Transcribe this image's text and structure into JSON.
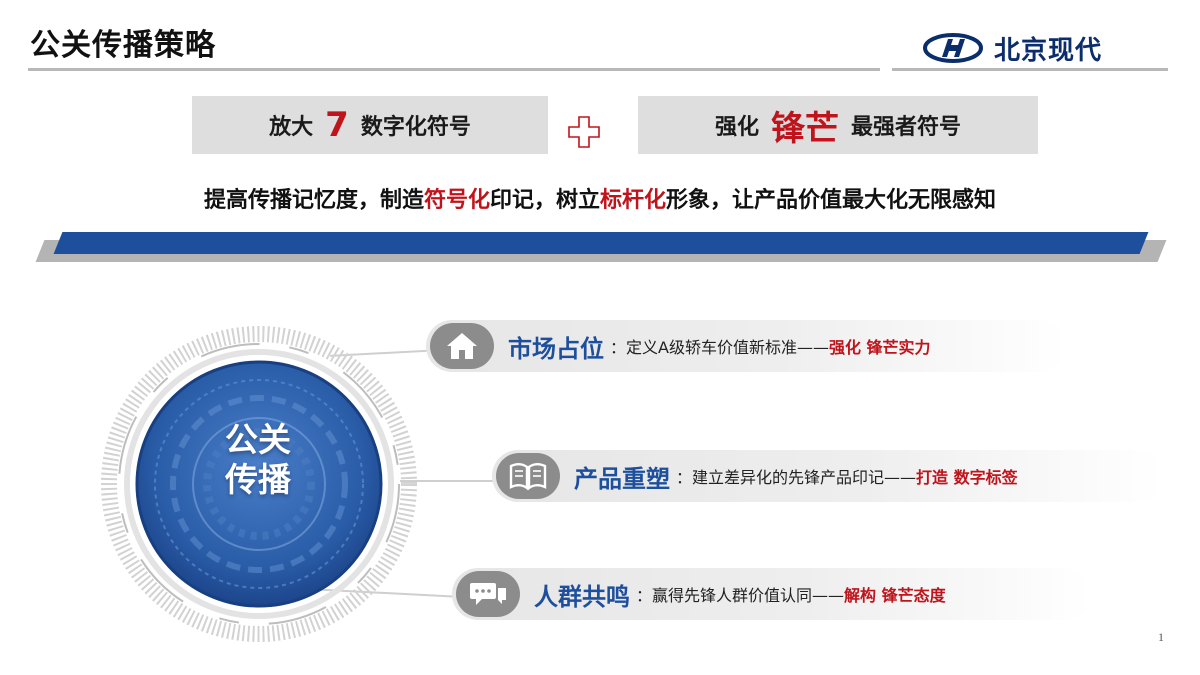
{
  "header": {
    "title": "公关传播策略",
    "logo_text": "北京现代",
    "logo_icon": "hyundai-logo-icon",
    "brand_color": "#0b2d6b"
  },
  "pills": {
    "left": {
      "prefix": "放大",
      "highlight": "7",
      "suffix": "数字化符号"
    },
    "right": {
      "prefix": "强化",
      "highlight": "锋芒",
      "suffix": "最强者符号"
    },
    "plus_icon": "plus-icon"
  },
  "slogan": {
    "part1": "提高传播记忆度，制造",
    "em1": "符号化",
    "part2": "印记，树立",
    "em2": "标杆化",
    "part3": "形象，让产品价值最大化无限感知"
  },
  "center": {
    "line1": "公关",
    "line2": "传播"
  },
  "items": [
    {
      "icon": "house-icon",
      "heading": "市场占位",
      "desc": "：定义A级轿车价值新标准——",
      "tail": "强化  锋芒实力"
    },
    {
      "icon": "book-icon",
      "heading": "产品重塑",
      "desc": "：建立差异化的先锋产品印记——",
      "tail": "打造  数字标签"
    },
    {
      "icon": "chat-icon",
      "heading": "人群共鸣",
      "desc": "：赢得先锋人群价值认同——",
      "tail": "解构  锋芒态度"
    }
  ],
  "colors": {
    "accent_blue": "#1d4f9c",
    "accent_red": "#c0141c",
    "pill_gray": "#dedede"
  },
  "page_number": "1"
}
